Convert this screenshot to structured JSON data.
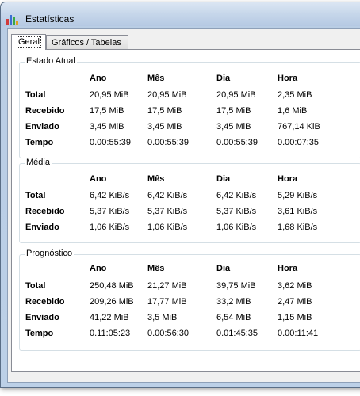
{
  "window": {
    "title": "Estatísticas",
    "icon": "bar-chart-icon"
  },
  "tabs": [
    {
      "label": "Geral",
      "active": true
    },
    {
      "label": "Gráficos / Tabelas",
      "active": false
    }
  ],
  "columns": [
    "Ano",
    "Mês",
    "Dia",
    "Hora"
  ],
  "estado_atual": {
    "title": "Estado Atual",
    "rows": [
      {
        "label": "Total",
        "values": [
          "20,95 MiB",
          "20,95 MiB",
          "20,95 MiB",
          "2,35 MiB"
        ]
      },
      {
        "label": "Recebido",
        "values": [
          "17,5 MiB",
          "17,5 MiB",
          "17,5 MiB",
          "1,6 MiB"
        ]
      },
      {
        "label": "Enviado",
        "values": [
          "3,45 MiB",
          "3,45 MiB",
          "3,45 MiB",
          "767,14 KiB"
        ]
      },
      {
        "label": "Tempo",
        "values": [
          "0.00:55:39",
          "0.00:55:39",
          "0.00:55:39",
          "0.00:07:35"
        ]
      }
    ]
  },
  "media": {
    "title": "Média",
    "rows": [
      {
        "label": "Total",
        "values": [
          "6,42 KiB/s",
          "6,42 KiB/s",
          "6,42 KiB/s",
          "5,29 KiB/s"
        ]
      },
      {
        "label": "Recebido",
        "values": [
          "5,37 KiB/s",
          "5,37 KiB/s",
          "5,37 KiB/s",
          "3,61 KiB/s"
        ]
      },
      {
        "label": "Enviado",
        "values": [
          "1,06 KiB/s",
          "1,06 KiB/s",
          "1,06 KiB/s",
          "1,68 KiB/s"
        ]
      }
    ]
  },
  "prognostico": {
    "title": "Prognóstico",
    "rows": [
      {
        "label": "Total",
        "values": [
          "250,48 MiB",
          "21,27 MiB",
          "39,75 MiB",
          "3,62 MiB"
        ]
      },
      {
        "label": "Recebido",
        "values": [
          "209,26 MiB",
          "17,77 MiB",
          "33,2 MiB",
          "2,47 MiB"
        ]
      },
      {
        "label": "Enviado",
        "values": [
          "41,22 MiB",
          "3,5 MiB",
          "6,54 MiB",
          "1,15 MiB"
        ]
      },
      {
        "label": "Tempo",
        "values": [
          "0.11:05:23",
          "0.00:56:30",
          "0.01:45:35",
          "0.00:11:41"
        ]
      }
    ]
  }
}
